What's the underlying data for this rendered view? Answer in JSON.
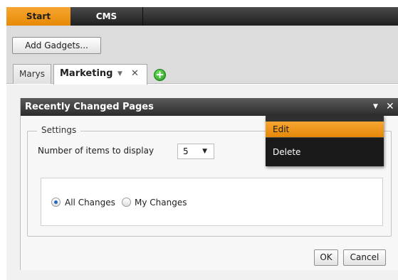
{
  "menubar": {
    "tabs": [
      {
        "label": "Start",
        "active": true
      },
      {
        "label": "CMS",
        "active": false
      }
    ]
  },
  "toolbar": {
    "add_gadgets_label": "Add Gadgets..."
  },
  "page_tabs": {
    "items": [
      {
        "label": "Marys",
        "active": false
      },
      {
        "label": "Marketing",
        "active": true
      }
    ],
    "dropdown_glyph": "▼",
    "close_glyph": "✕",
    "add_glyph": "+"
  },
  "gadget": {
    "title": "Recently Changed Pages",
    "header_dropdown_glyph": "▼",
    "header_close_glyph": "✕",
    "settings": {
      "legend": "Settings",
      "items_label": "Number of items to display",
      "items_value": "5",
      "select_arrow_glyph": "▼",
      "filter_options": [
        {
          "label": "All Changes",
          "selected": true
        },
        {
          "label": "My Changes",
          "selected": false
        }
      ]
    },
    "ok_label": "OK",
    "cancel_label": "Cancel"
  },
  "context_menu": {
    "items": [
      {
        "label": "Edit",
        "highlighted": true
      },
      {
        "label": "Delete",
        "highlighted": false
      }
    ]
  },
  "colors": {
    "accent_orange": "#f09a1e",
    "menubar_dark": "#2a2a2a",
    "add_green": "#2fb126",
    "radio_selected": "#2466c8"
  }
}
